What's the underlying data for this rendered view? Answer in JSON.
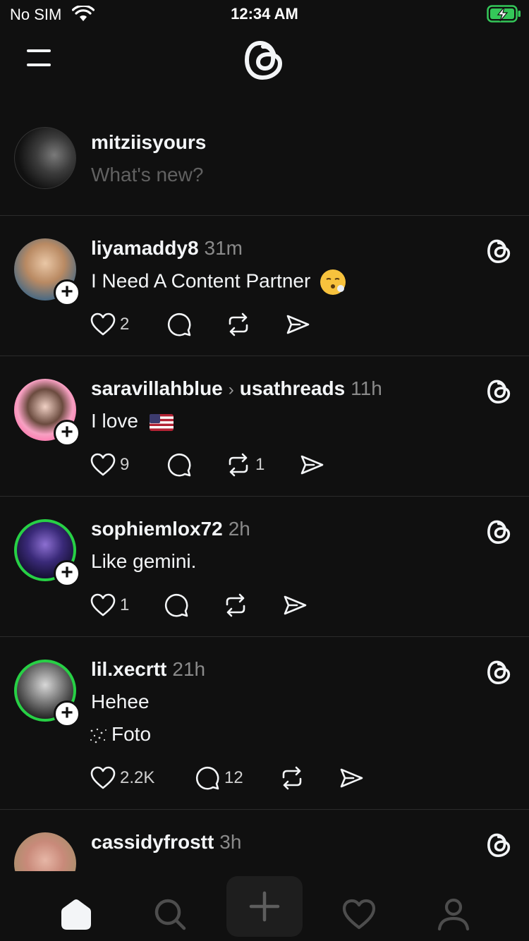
{
  "status_bar": {
    "carrier": "No SIM",
    "time": "12:34 AM"
  },
  "composer": {
    "username": "mitziisyours",
    "placeholder": "What's new?"
  },
  "posts": [
    {
      "username": "liyamaddy8",
      "time": "31m",
      "text": "I Need A Content Partner",
      "likes": "2",
      "replies": "",
      "reposts": "",
      "emoji": "face-exhaling"
    },
    {
      "username": "saravillahblue",
      "reply_to": "usathreads",
      "time": "11h",
      "text": "I love",
      "likes": "9",
      "replies": "",
      "reposts": "1",
      "emoji": "flag-us"
    },
    {
      "username": "sophiemlox72",
      "time": "2h",
      "text": "Like gemini.",
      "likes": "1",
      "replies": "",
      "reposts": ""
    },
    {
      "username": "lil.xecrtt",
      "time": "21h",
      "text": "Hehee",
      "subtext": "Foto",
      "likes": "2.2K",
      "replies": "12",
      "reposts": ""
    },
    {
      "username": "cassidyfrostt",
      "time": "3h"
    }
  ],
  "icons": {
    "header": [
      "menu-icon",
      "threads-logo-icon"
    ],
    "post_actions": [
      "heart-icon",
      "comment-icon",
      "repost-icon",
      "share-icon"
    ],
    "tabs": [
      "home-icon",
      "search-icon",
      "plus-icon",
      "heart-icon",
      "profile-icon"
    ]
  },
  "colors": {
    "background": "#101010",
    "text": "#f3f5f7",
    "muted": "#8a8a8a",
    "story_ring": "#27d045",
    "battery": "#34c759"
  }
}
